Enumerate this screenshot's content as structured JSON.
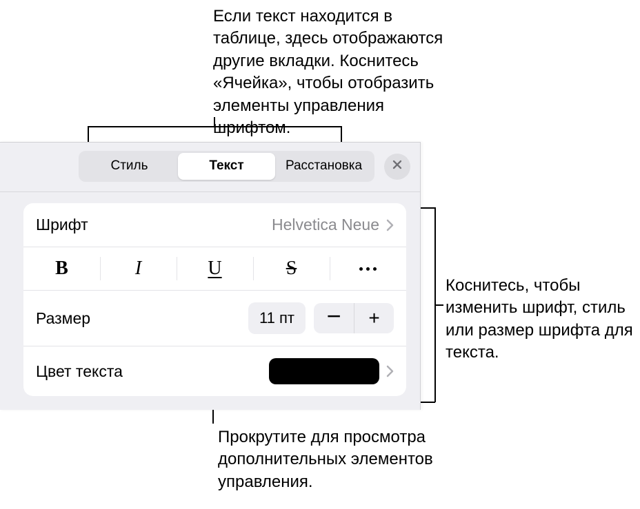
{
  "callouts": {
    "top": "Если текст находится в таблице, здесь отображаются другие вкладки. Коснитесь «Ячейка», чтобы отобразить элементы управления шрифтом.",
    "right": "Коснитесь, чтобы изменить шрифт, стиль или размер шрифта для текста.",
    "bottom": "Прокрутите для просмотра дополнительных элементов управления."
  },
  "tabs": {
    "style": "Стиль",
    "text": "Текст",
    "arrange": "Расстановка"
  },
  "font": {
    "label": "Шрифт",
    "value": "Helvetica Neue"
  },
  "style_buttons": {
    "bold": "B",
    "italic": "I",
    "underline": "U",
    "strike": "S"
  },
  "size": {
    "label": "Размер",
    "value": "11 пт",
    "minus": "−",
    "plus": "+"
  },
  "text_color": {
    "label": "Цвет текста",
    "value_hex": "#000000"
  }
}
